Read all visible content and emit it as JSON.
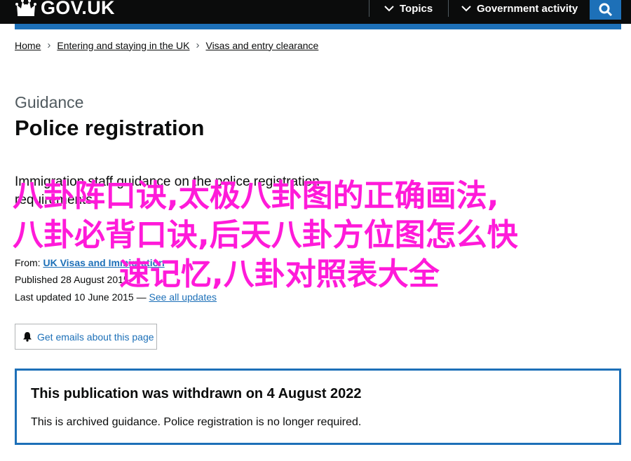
{
  "header": {
    "logo_text": "GOV.UK",
    "nav": [
      {
        "label": "Topics",
        "icon": "chevron-down-icon"
      },
      {
        "label": "Government activity",
        "icon": "chevron-down-icon"
      }
    ],
    "search_icon": "search-icon"
  },
  "breadcrumb": [
    "Home",
    "Entering and staying in the UK",
    "Visas and entry clearance"
  ],
  "page": {
    "caption": "Guidance",
    "title": "Police registration",
    "lead": "Immigration staff guidance on the police registration requirements."
  },
  "metadata": {
    "from_label": "From:",
    "from_value": "UK Visas and Immigration",
    "published_label": "Published",
    "published_value": "28 August 2015",
    "updated_label": "Last updated",
    "updated_value": "10 June 2015 —",
    "see_updates": "See all updates"
  },
  "email_button": {
    "label": "Get emails about this page",
    "icon": "bell-icon"
  },
  "notice": {
    "title": "This publication was withdrawn on 4 August 2022",
    "body": "This is archived guidance. Police registration is no longer required."
  },
  "overlay": {
    "line1": "八卦阵口诀,太极八卦图的正确画法,",
    "line2": "八卦必背口诀,后天八卦方位图怎么快",
    "line3": "速记忆,八卦对照表大全"
  },
  "colors": {
    "header_bg": "#0b0c0c",
    "brand_blue": "#1d70b8",
    "overlay_text": "#ff1ad9"
  }
}
